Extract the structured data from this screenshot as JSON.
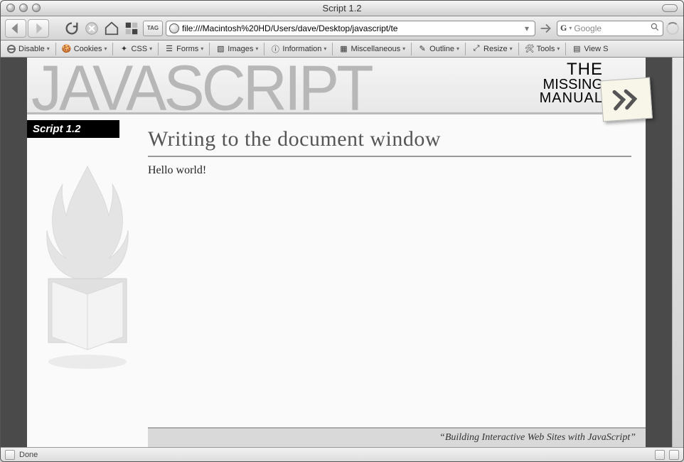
{
  "window": {
    "title": "Script 1.2"
  },
  "toolbar": {
    "url": "file:///Macintosh%20HD/Users/dave/Desktop/javascript/te",
    "search_placeholder": "Google",
    "search_hint_icon": "G"
  },
  "devbar": {
    "items": [
      "Disable",
      "Cookies",
      "CSS",
      "Forms",
      "Images",
      "Information",
      "Miscellaneous",
      "Outline",
      "Resize",
      "Tools",
      "View S"
    ]
  },
  "banner": {
    "big": "JAVASCRIPT",
    "mm_l1": "THE",
    "mm_l2": "MISSING",
    "mm_l3": "MANUAL"
  },
  "page": {
    "script_label": "Script 1.2",
    "heading": "Writing to the document window",
    "body": "Hello world!",
    "footer": "“Building Interactive Web Sites with JavaScript”"
  },
  "status": {
    "text": "Done"
  }
}
